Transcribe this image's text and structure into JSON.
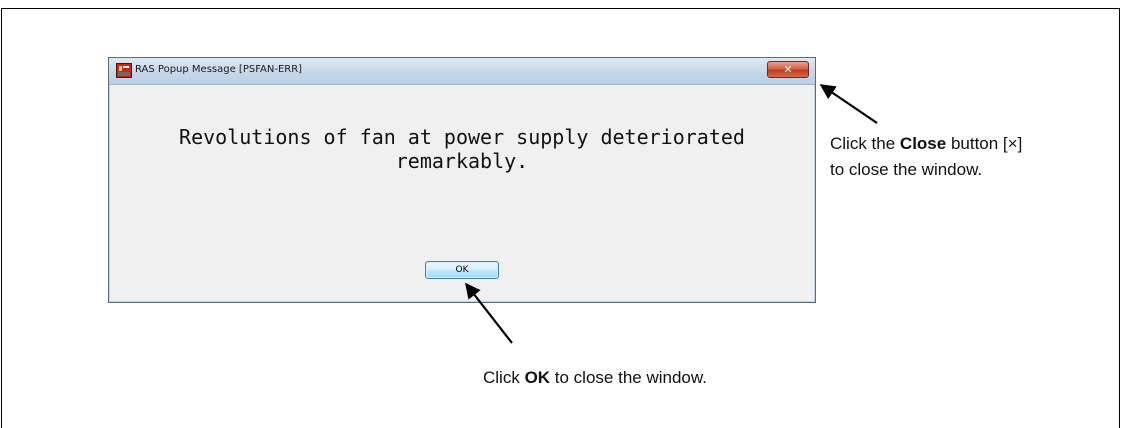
{
  "window": {
    "title": "RAS Popup Message [PSFAN-ERR]",
    "close_glyph": "✕",
    "message_lines": [
      "Revolutions of fan at power supply deteriorated",
      "remarkably."
    ],
    "ok_label": "OK"
  },
  "callouts": {
    "close": {
      "pre": "Click the ",
      "bold": "Close",
      "post_line1": " button [×]",
      "line2": "to close the window."
    },
    "ok": {
      "pre": "Click ",
      "bold": "OK",
      "post": " to close the window."
    }
  },
  "icons": {
    "app": "ras-app-icon",
    "close": "close-icon",
    "arrows": [
      "callout-arrow-close",
      "callout-arrow-ok"
    ]
  }
}
